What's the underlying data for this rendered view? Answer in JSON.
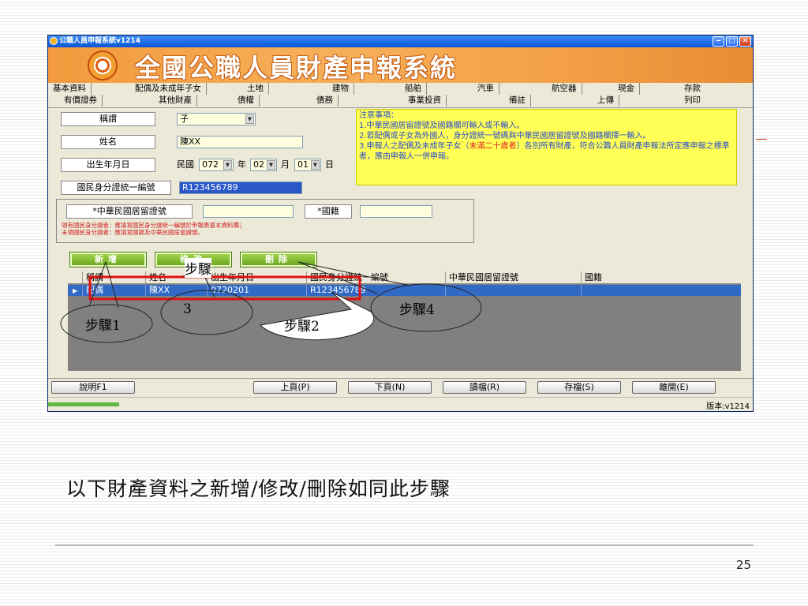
{
  "window": {
    "title": "公職人員申報系統v1214",
    "banner_title": "全國公職人員財產申報系統",
    "controls": [
      "‒",
      "□",
      "✕"
    ]
  },
  "tabs": {
    "row1": [
      "基本資料",
      "配偶及未成年子女",
      "土地",
      "建物",
      "船舶",
      "汽車",
      "航空器",
      "現金",
      "存款"
    ],
    "row2": [
      "有價證券",
      "其他財產",
      "債權",
      "債務",
      "事業投資",
      "備註",
      "上傳",
      "列印"
    ]
  },
  "form": {
    "title_label": "稱謂",
    "title_value": "子",
    "name_label": "姓名",
    "name_value": "陳XX",
    "birth_label": "出生年月日",
    "birth_era": "民國",
    "birth_year": "072",
    "year_unit": "年",
    "birth_month": "02",
    "month_unit": "月",
    "birth_day": "01",
    "day_unit": "日",
    "id_label": "國民身分證統一編號",
    "id_value": "R123456789",
    "residence_label": "*中華民國居留證號",
    "residence_value": "",
    "nationality_label": "*國籍",
    "nationality_value": "",
    "hint_line1": "領有國民身分證者：應填寫國民身分證統一編號於申報表基本資料欄；",
    "hint_line2": "未領國民身分證者：應填寫國籍及中華民國居留證號。"
  },
  "notes": {
    "heading": "注意事項：",
    "n1": "1.中華民國居留證號及國籍欄可輸入或不輸入。",
    "n2": "2.若配偶或子女為外國人，身分證統一號碼與中華民國居留證號及國籍欄擇一輸入。",
    "n3a": "3.申報人之配偶及未成年子女（",
    "n3b": "未滿二十歲者",
    "n3c": "）各別所有財產，符合公職人員財產申報法所定應申報之標準者，應由申報人一併申報。"
  },
  "actions": {
    "add": "新增",
    "edit": "修改",
    "delete": "刪除"
  },
  "grid": {
    "headers": [
      "稱謂",
      "姓名",
      "出生年月日",
      "國民身分證統一編號",
      "中華民國居留證號",
      "國籍"
    ],
    "row": {
      "marker": "▶",
      "title": "配偶",
      "name": "陳XX",
      "birth": "0720201",
      "id": "R123456789",
      "residence": "",
      "nationality": ""
    }
  },
  "bottom_buttons": {
    "help": "說明F1",
    "prev": "上頁(P)",
    "next": "下頁(N)",
    "read": "讀檔(R)",
    "save": "存檔(S)",
    "exit": "離開(E)"
  },
  "status": {
    "version": "版本:v1214"
  },
  "annotations": {
    "step1": "步驟1",
    "step2": "步驟2",
    "step3_top": "步驟",
    "step3_num": "3",
    "step4": "步驟4"
  },
  "slide": {
    "caption": "以下財產資料之新增/修改/刪除如同此步驟",
    "page_number": "25"
  },
  "colors": {
    "banner": "#f29a3c",
    "notes_bg": "#ffff55",
    "notes_text": "#2a4ad0",
    "warning_red": "#e02020",
    "action_green": "#7ab830",
    "selection_blue": "#316ac5",
    "highlight_box": "#e01010"
  }
}
